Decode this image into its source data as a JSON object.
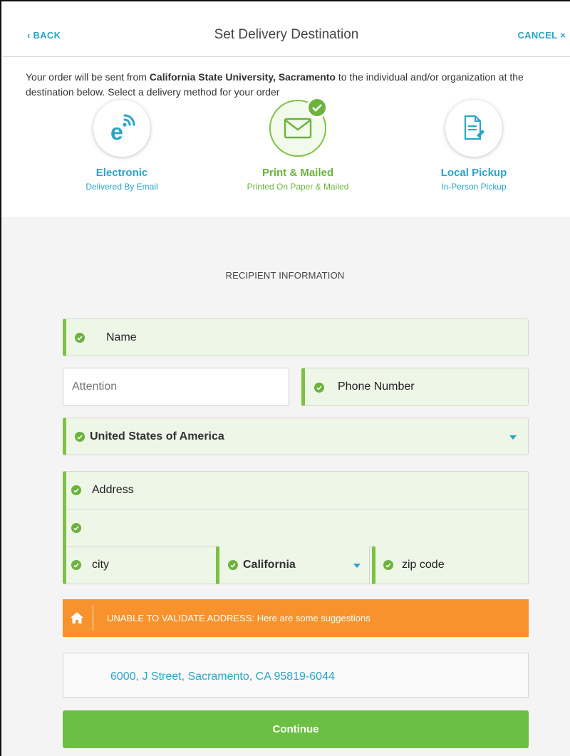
{
  "header": {
    "back_label": "‹ BACK",
    "title": "Set Delivery Destination",
    "cancel_label": "CANCEL ×"
  },
  "intro": {
    "text_before": "Your order will be sent from ",
    "institution": "California State University, Sacramento",
    "text_after": " to the individual and/or organization at the destination below. Select a delivery method for your order"
  },
  "methods": [
    {
      "title": "Electronic",
      "subtitle": "Delivered By Email",
      "icon": "electronic-e-icon",
      "selected": false
    },
    {
      "title": "Print & Mailed",
      "subtitle": "Printed On Paper & Mailed",
      "icon": "envelope-icon",
      "selected": true
    },
    {
      "title": "Local Pickup",
      "subtitle": "In-Person Pickup",
      "icon": "document-pickup-icon",
      "selected": false
    }
  ],
  "form": {
    "section_title": "RECIPIENT INFORMATION",
    "name_placeholder": "Name",
    "attention_placeholder": "Attention",
    "phone_placeholder": "Phone Number",
    "country_value": "United States of America",
    "address_placeholder": "Address",
    "address2_value": "",
    "city_placeholder": "city",
    "state_value": "California",
    "zip_placeholder": "zip code"
  },
  "alert": {
    "icon": "home-icon",
    "text": "UNABLE TO VALIDATE ADDRESS: Here are some suggestions"
  },
  "suggestion": {
    "address": "6000, J Street, Sacramento, CA 95819-6044"
  },
  "continue_label": "Continue",
  "colors": {
    "accent_blue": "#2aa4c9",
    "accent_green": "#6cb33e",
    "field_bg": "#eef6e8",
    "warning_orange": "#f7922c",
    "button_green": "#6cbf45"
  }
}
